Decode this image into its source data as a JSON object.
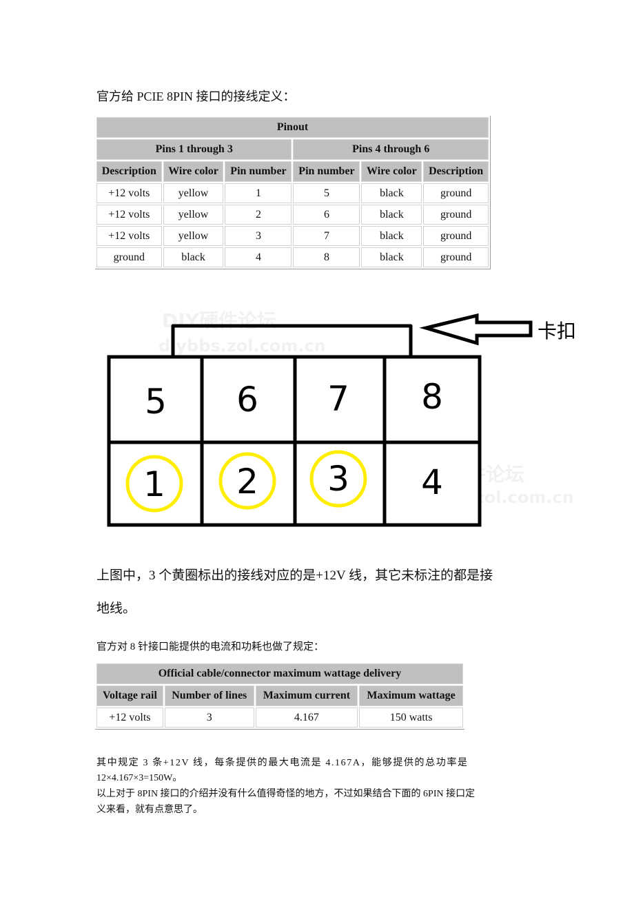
{
  "intro_text": "官方给 PCIE 8PIN 接口的接线定义：",
  "pinout_table": {
    "title": "Pinout",
    "group_headers": [
      "Pins 1 through 3",
      "Pins 4 through 6"
    ],
    "column_headers": [
      "Description",
      "Wire color",
      "Pin number",
      "Pin number",
      "Wire color",
      "Description"
    ],
    "rows": [
      [
        "+12 volts",
        "yellow",
        "1",
        "5",
        "black",
        "ground"
      ],
      [
        "+12 volts",
        "yellow",
        "2",
        "6",
        "black",
        "ground"
      ],
      [
        "+12 volts",
        "yellow",
        "3",
        "7",
        "black",
        "ground"
      ],
      [
        "ground",
        "black",
        "4",
        "8",
        "black",
        "ground"
      ]
    ]
  },
  "diagram": {
    "latch_label": "卡扣",
    "top_row_pins": [
      "5",
      "6",
      "7",
      "8"
    ],
    "bottom_row_pins": [
      "1",
      "2",
      "3",
      "4"
    ],
    "highlighted_pins": [
      "1",
      "2",
      "3"
    ],
    "highlight_color": "#ffee00",
    "watermark_title": "DIY硬件论坛",
    "watermark_url": "diybbs.zol.com.cn"
  },
  "desc_line1": "上图中，3 个黄圈标出的接线对应的是+12V 线，其它未标注的都是接",
  "desc_line2": "地线。",
  "spec_intro": "官方对 8 针接口能提供的电流和功耗也做了规定：",
  "wattage_table": {
    "title": "Official cable/connector maximum wattage delivery",
    "column_headers": [
      "Voltage rail",
      "Number of lines",
      "Maximum current",
      "Maximum wattage"
    ],
    "rows": [
      [
        "+12 volts",
        "3",
        "4.167",
        "150 watts"
      ]
    ]
  },
  "note_line1": "其中规定 3 条+12V 线，每条提供的最大电流是 4.167A，能够提供的总功率是",
  "note_line2": "12×4.167×3=150W。",
  "note_line3": "以上对于 8PIN 接口的介绍并没有什么值得奇怪的地方，不过如果结合下面的 6PIN 接口定",
  "note_line4": "义来看，就有点意思了。"
}
